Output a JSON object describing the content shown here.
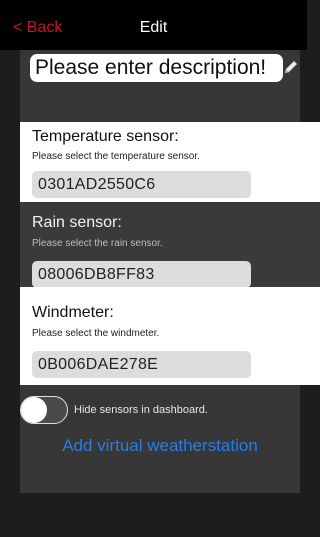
{
  "navbar": {
    "back_label": "< Back",
    "title": "Edit"
  },
  "description": {
    "value": "Please enter description!"
  },
  "sensors": [
    {
      "title": "Temperature sensor:",
      "hint": "Please select the temperature sensor.",
      "value": "0301AD2550C6"
    },
    {
      "title": "Rain sensor:",
      "hint": "Please select the rain sensor.",
      "value": "08006DB8FF83"
    },
    {
      "title": "Windmeter:",
      "hint": "Please select the windmeter.",
      "value": "0B006DAE278E"
    }
  ],
  "options": {
    "hide_in_dashboard_label": "Hide sensors in dashboard.",
    "hide_in_dashboard_on": false
  },
  "actions": {
    "add_virtual_label": "Add virtual weatherstation"
  },
  "colors": {
    "back": "#d0112b",
    "link": "#2a7de1",
    "navbar": "#000000"
  }
}
